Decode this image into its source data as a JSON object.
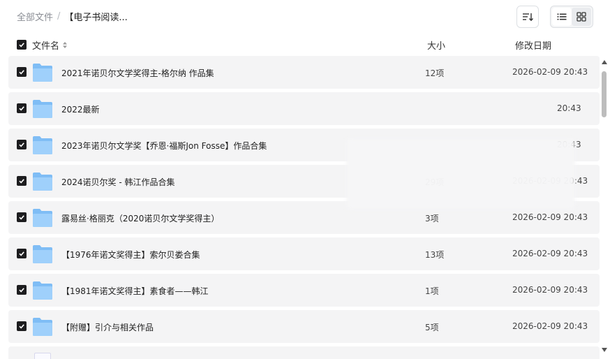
{
  "breadcrumb": {
    "root": "全部文件",
    "separator": "/",
    "current": "【电子书阅读..."
  },
  "toolbar": {
    "sort_icon": "sort-lines-icon",
    "view_list_icon": "list-view-icon",
    "view_grid_icon": "grid-view-icon",
    "active_view": "list"
  },
  "columns": {
    "name": "文件名",
    "size": "大小",
    "date": "修改日期"
  },
  "colors": {
    "checkbox": "#1d1d1f",
    "row_bg": "#f4f4f5",
    "folder": "#7fbdf5"
  },
  "files": [
    {
      "name": "2021年诺贝尔文学奖得主-格尔纳 作品集",
      "size": "12项",
      "date": "2026-02-09 20:43",
      "checked": true
    },
    {
      "name": "2022最新",
      "size": "",
      "date": "20:43",
      "checked": true
    },
    {
      "name": "2023年诺贝尔文学奖【乔恩·福斯Jon Fosse】作品合集",
      "size": "",
      "date": "20:43",
      "checked": true
    },
    {
      "name": "2024诺贝尔奖 - 韩江作品合集",
      "size": "29项",
      "date": "2026-02-09 20:43",
      "checked": true
    },
    {
      "name": "露易丝·格丽克（2020诺贝尔文学奖得主）",
      "size": "3项",
      "date": "2026-02-09 20:43",
      "checked": true
    },
    {
      "name": "【1976年诺文奖得主】索尔贝娄合集",
      "size": "13项",
      "date": "2026-02-09 20:43",
      "checked": true
    },
    {
      "name": "【1981年诺文奖得主】素食者——韩江",
      "size": "1项",
      "date": "2026-02-09 20:43",
      "checked": true
    },
    {
      "name": "【附赠】引介与相关作品",
      "size": "5项",
      "date": "2026-02-09 20:43",
      "checked": true
    }
  ]
}
